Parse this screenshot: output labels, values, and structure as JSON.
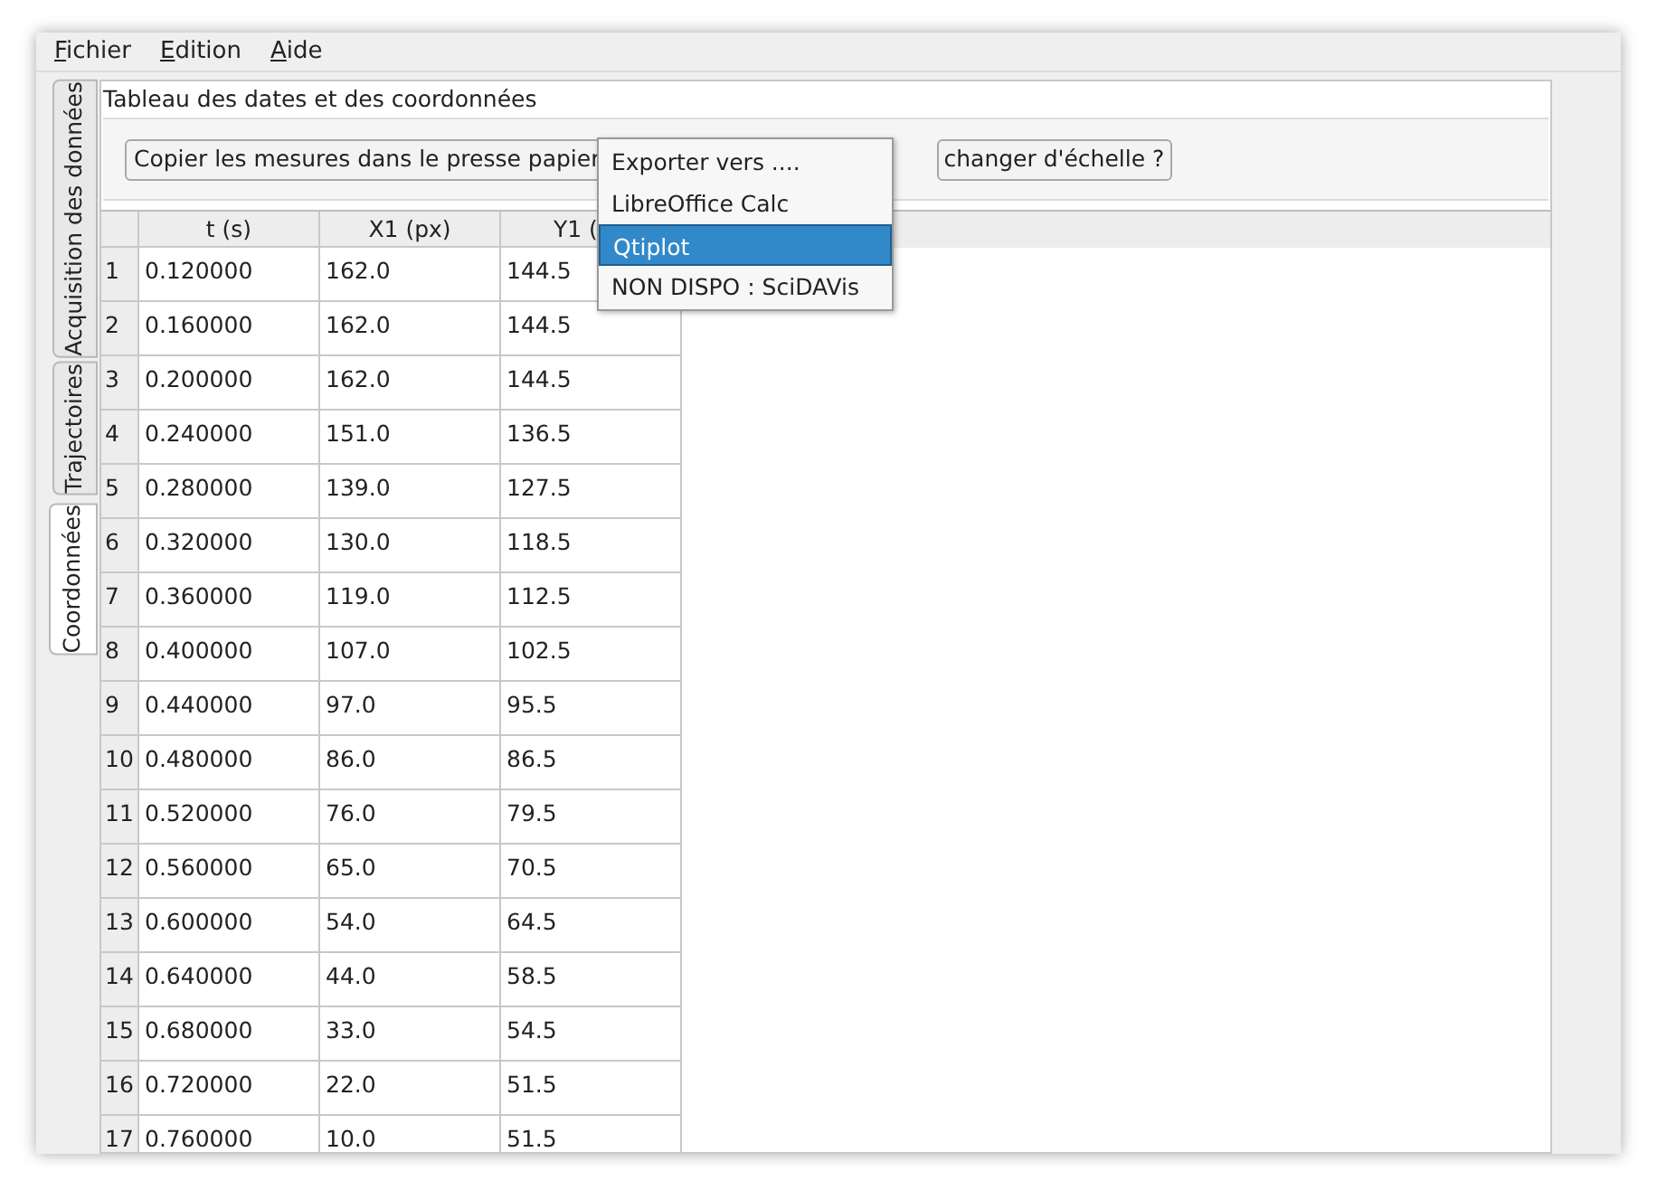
{
  "menu_bar": [
    {
      "label": "Fichier"
    },
    {
      "label": "Edition"
    },
    {
      "label": "Aide"
    }
  ],
  "side_tabs": [
    {
      "label": "Acquisition des données",
      "selected": false
    },
    {
      "label": "Trajectoires",
      "selected": false
    },
    {
      "label": "Coordonnées",
      "selected": true
    }
  ],
  "panel_title": "Tableau des dates et des coordonnées",
  "copy_button": "Copier les mesures dans le presse papier",
  "scale_button": "changer d'échelle ?",
  "export_menu": [
    {
      "label": "Exporter vers ....",
      "selected": false
    },
    {
      "label": "LibreOffice Calc",
      "selected": false
    },
    {
      "label": "Qtiplot",
      "selected": true
    },
    {
      "label": "NON DISPO : SciDAVis",
      "selected": false
    }
  ],
  "table": {
    "columns": [
      "t (s)",
      "X1 (px)",
      "Y1 ("
    ],
    "rows": [
      {
        "index": "1",
        "cells": [
          "0.120000",
          "162.0",
          "144.5"
        ]
      },
      {
        "index": "2",
        "cells": [
          "0.160000",
          "162.0",
          "144.5"
        ]
      },
      {
        "index": "3",
        "cells": [
          "0.200000",
          "162.0",
          "144.5"
        ]
      },
      {
        "index": "4",
        "cells": [
          "0.240000",
          "151.0",
          "136.5"
        ]
      },
      {
        "index": "5",
        "cells": [
          "0.280000",
          "139.0",
          "127.5"
        ]
      },
      {
        "index": "6",
        "cells": [
          "0.320000",
          "130.0",
          "118.5"
        ]
      },
      {
        "index": "7",
        "cells": [
          "0.360000",
          "119.0",
          "112.5"
        ]
      },
      {
        "index": "8",
        "cells": [
          "0.400000",
          "107.0",
          "102.5"
        ]
      },
      {
        "index": "9",
        "cells": [
          "0.440000",
          "97.0",
          "95.5"
        ]
      },
      {
        "index": "10",
        "cells": [
          "0.480000",
          "86.0",
          "86.5"
        ]
      },
      {
        "index": "11",
        "cells": [
          "0.520000",
          "76.0",
          "79.5"
        ]
      },
      {
        "index": "12",
        "cells": [
          "0.560000",
          "65.0",
          "70.5"
        ]
      },
      {
        "index": "13",
        "cells": [
          "0.600000",
          "54.0",
          "64.5"
        ]
      },
      {
        "index": "14",
        "cells": [
          "0.640000",
          "44.0",
          "58.5"
        ]
      },
      {
        "index": "15",
        "cells": [
          "0.680000",
          "33.0",
          "54.5"
        ]
      },
      {
        "index": "16",
        "cells": [
          "0.720000",
          "22.0",
          "51.5"
        ]
      },
      {
        "index": "17",
        "cells": [
          "0.760000",
          "10.0",
          "51.5"
        ]
      }
    ]
  }
}
